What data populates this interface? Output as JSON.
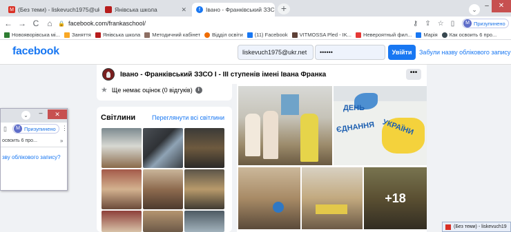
{
  "browser": {
    "tabs": [
      {
        "title": "(Без теми) - liskevuch1975@uk",
        "active": false
      },
      {
        "title": "Янівська школа",
        "active": false
      },
      {
        "title": "Івано - Франківський ЗЗСО І - ІІ",
        "active": true
      }
    ],
    "new_tab": "+",
    "url": "facebook.com/frankaschool/",
    "profile_label": "Призупинено",
    "profile_initial": "M",
    "bookmarks": [
      "Новояворівська мі...",
      "Заняття",
      "Янівська школа",
      "Методичний кабінет",
      "Відділ освіти",
      "(11) Facebook",
      "VITMOSSA Pled - IK...",
      "Невероятный фил...",
      "Марія",
      "Как освоить 6 про..."
    ]
  },
  "facebook": {
    "logo": "facebook",
    "email_value": "liskevuch1975@ukr.net",
    "password_value": "••••••",
    "login_button": "Увійти",
    "forgot_link": "Забули назву облікового запису?"
  },
  "page": {
    "name": "Івано - Франківський ЗЗСО І - ІІІ ступенів імені Івана Франка",
    "more_button": "•••",
    "rating_text": "Ще немає оцінок (0 відгуків)",
    "photos_title": "Світлини",
    "photos_see_all": "Переглянути всі світлини",
    "poster_text_line1": "ДЕНЬ",
    "poster_text_line2": "ЄДНАННЯ",
    "poster_text_line3": "УКРАЇНИ",
    "more_photos": "+18"
  },
  "second_window": {
    "profile_label": "Призупинено",
    "profile_initial": "M",
    "bookmark": "освоить 6 про...",
    "link_text": "зву облікового запису?"
  },
  "taskbar": {
    "item": "(Без теми) - liskevuch19"
  },
  "colors": {
    "facebook_blue": "#1877f2",
    "page_bg": "#f0f2f5",
    "chrome_tabstrip": "#dee1e6"
  }
}
